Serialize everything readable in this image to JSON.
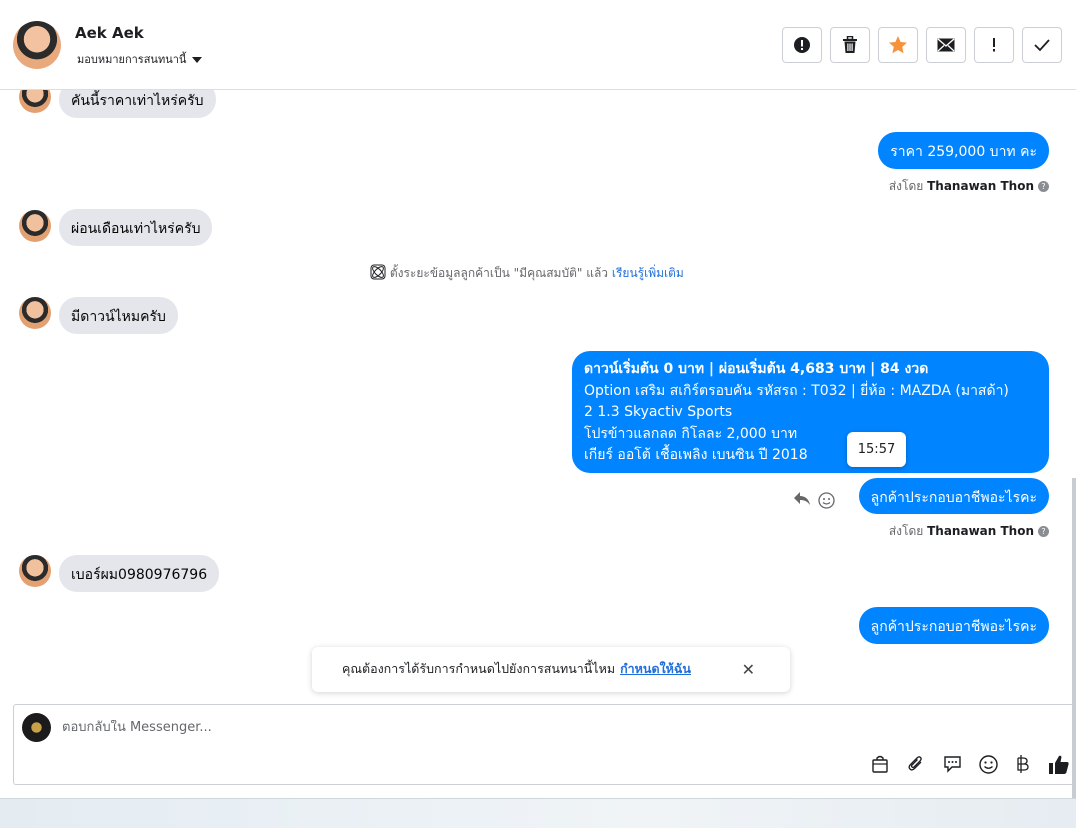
{
  "header": {
    "name": "Aek Aek",
    "assign_label": "มอบหมายการสนทนานี้",
    "actions": [
      "alert-icon",
      "trash-icon",
      "star-icon",
      "mail-icon",
      "exclamation-icon",
      "check-icon"
    ],
    "star_color": "#f7923a"
  },
  "messages": {
    "in1": "คันนี้ราคาเท่าไหร่ครับ",
    "out1": "ราคา 259,000 บาท  คะ",
    "sent_by_prefix": "ส่งโดย",
    "sent_by_name": "Thanawan Thon",
    "in2": "ผ่อนเดือนเท่าไหร่ครับ",
    "system_text": "ตั้งระยะข้อมูลลูกค้าเป็น \"มีคุณสมบัติ\" แล้ว",
    "system_link": "เรียนรู้เพิ่มเติม",
    "in3": "มีดาวน์ไหมครับ",
    "long_lines": [
      "ดาวน์เริ่มต้น 0 บาท | ผ่อนเริ่มต้น 4,683 บาท | 84 งวด",
      " Option เสริม สเกิร์ตรอบคัน  รหัสรถ : T032 |  ยี่ห้อ : MAZDA (มาสด้า)",
      "2 1.3 Skyactiv Sports",
      " โปรข้าวแลกลด กิโลละ 2,000 บาท",
      " เกียร์ ออโต้  เชื้อเพลิง เบนซิน  ปี 2018"
    ],
    "tooltip_time": "15:57",
    "out2": "ลูกค้าประกอบอาชีพอะไรคะ",
    "in4": "เบอร์ผม0980976796",
    "out3": "ลูกค้าประกอบอาชีพอะไรคะ"
  },
  "toast": {
    "text": "คุณต้องการได้รับการกำหนดไปยังการสนทนานี้ไหม",
    "link": "กำหนดให้ฉัน"
  },
  "composer": {
    "placeholder": "ตอบกลับใน Messenger...",
    "tools": [
      "bag-icon",
      "paperclip-icon",
      "chat-bubble-icon",
      "emoji-icon",
      "baht-icon",
      "thumbs-up-icon"
    ]
  },
  "colors": {
    "accent": "#0084ff",
    "incoming": "#e4e6eb",
    "link": "#216fdb"
  }
}
